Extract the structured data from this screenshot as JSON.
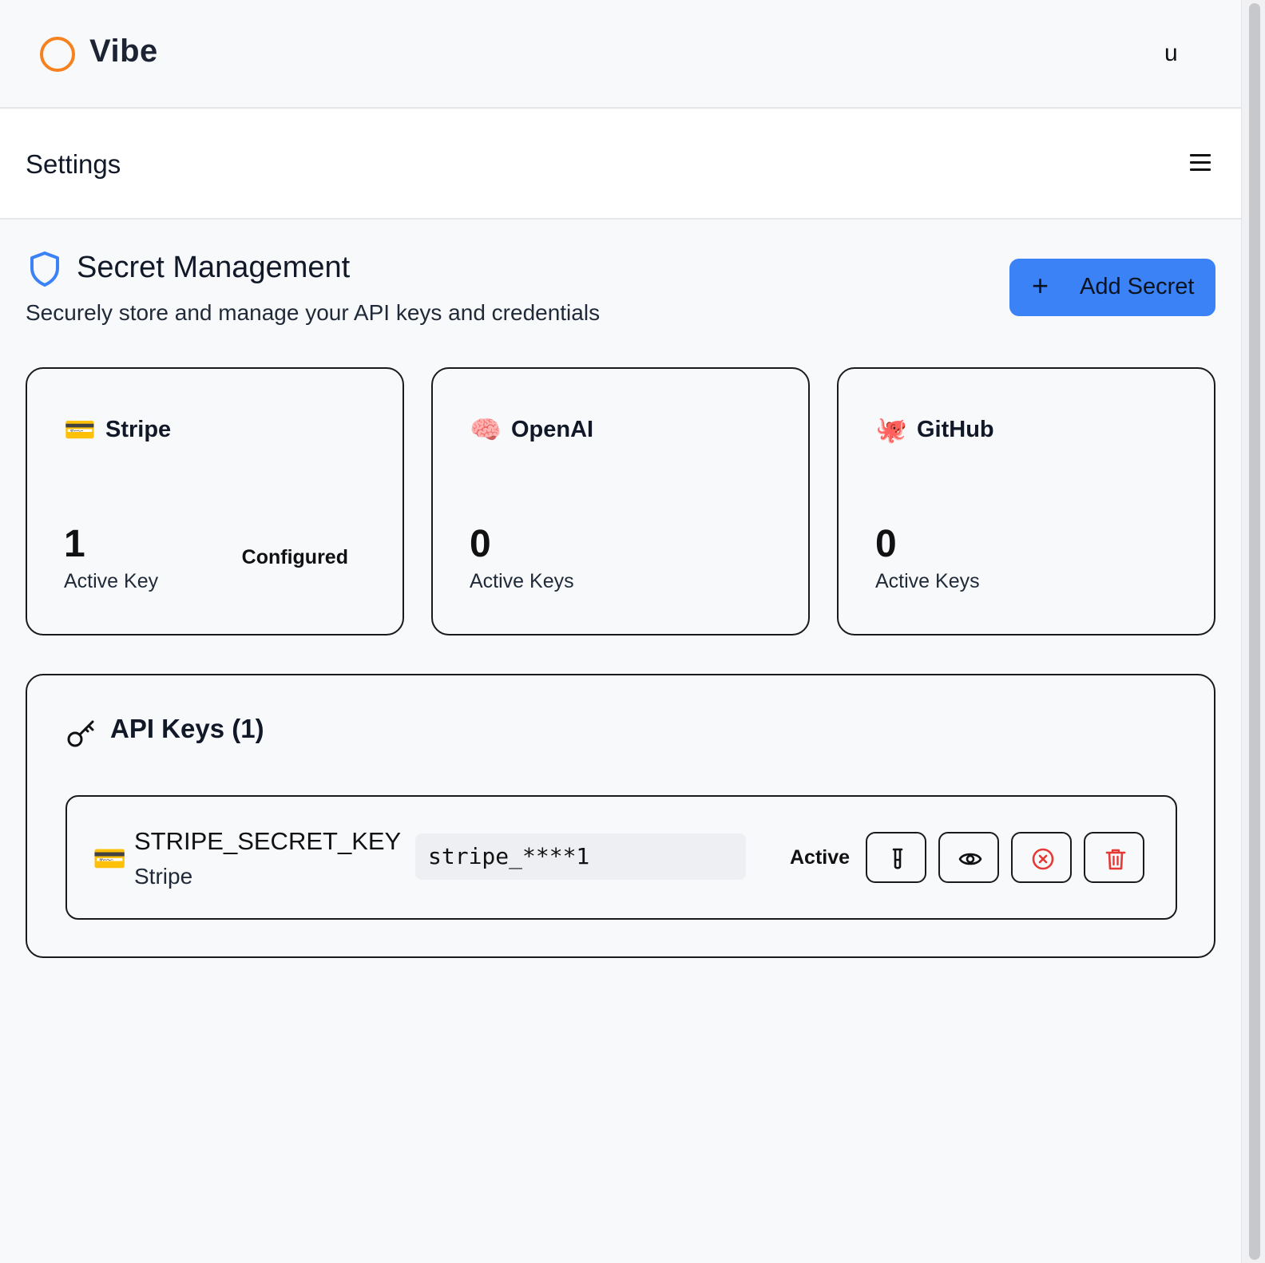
{
  "app": {
    "name": "Vibe",
    "user_initial": "u"
  },
  "header": {
    "title": "Settings",
    "menu_icon": "hamburger-menu-icon"
  },
  "section": {
    "icon": "shield-icon",
    "title": "Secret Management",
    "subtitle": "Securely store and manage your API keys and credentials",
    "add_button": {
      "icon": "+",
      "label": "Add Secret"
    }
  },
  "providers": [
    {
      "emoji": "💳",
      "name": "Stripe",
      "count": "1",
      "count_label": "Active Key",
      "status": "Configured"
    },
    {
      "emoji": "🧠",
      "name": "OpenAI",
      "count": "0",
      "count_label": "Active Keys",
      "status": ""
    },
    {
      "emoji": "🐙",
      "name": "GitHub",
      "count": "0",
      "count_label": "Active Keys",
      "status": ""
    }
  ],
  "api_keys": {
    "title": "API Keys (1)",
    "icon": "key-icon",
    "items": [
      {
        "emoji": "💳",
        "name": "STRIPE_SECRET_KEY",
        "provider": "Stripe",
        "masked_value": "stripe_****1",
        "status": "Active",
        "actions": [
          "test-icon",
          "eye-icon",
          "deactivate-icon",
          "trash-icon"
        ]
      }
    ]
  },
  "colors": {
    "accent": "#3b82f6",
    "logo": "#f58220",
    "danger": "#e53935",
    "shield": "#3b82f6"
  }
}
